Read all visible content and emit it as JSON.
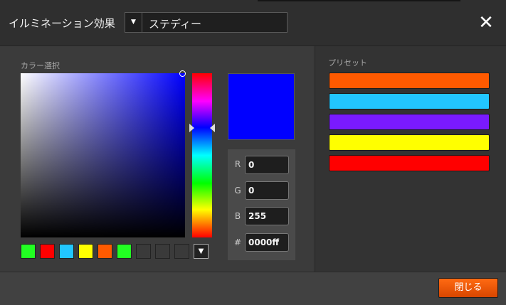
{
  "header": {
    "title": "イルミネーション効果",
    "mode_select": {
      "arrow": "▼",
      "value": "ステディー"
    },
    "close_icon": "✕"
  },
  "color_picker": {
    "label": "カラー選択",
    "selected_color": "#0000ff",
    "rgb": {
      "r_label": "R",
      "r_value": "0",
      "g_label": "G",
      "g_value": "0",
      "b_label": "B",
      "b_value": "255",
      "hex_label": "#",
      "hex_value": "0000ff"
    },
    "swatches": [
      "#22ff22",
      "#ff0000",
      "#22c6ff",
      "#ffff00",
      "#ff5a00",
      "#22ff22",
      "#3a3a3a",
      "#3a3a3a",
      "#3a3a3a"
    ],
    "swatch_menu_icon": "▼"
  },
  "presets": {
    "label": "プリセット",
    "colors": [
      "#ff5a00",
      "#22c6ff",
      "#7a1aff",
      "#ffff00",
      "#ff0000"
    ]
  },
  "footer": {
    "close_button_label": "閉じる"
  }
}
